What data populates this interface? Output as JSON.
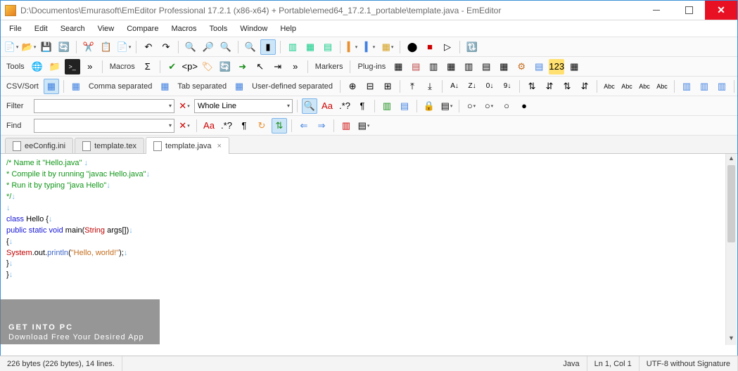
{
  "titlebar": {
    "title": "D:\\Documentos\\Emurasoft\\EmEditor Professional 17.2.1 (x86-x64) + Portable\\emed64_17.2.1_portable\\template.java - EmEditor"
  },
  "menu": {
    "items": [
      "File",
      "Edit",
      "Search",
      "View",
      "Compare",
      "Macros",
      "Tools",
      "Window",
      "Help"
    ]
  },
  "toolbar2_labels": {
    "tools": "Tools",
    "macros": "Macros",
    "markers": "Markers",
    "plugins": "Plug-ins"
  },
  "csv_row": {
    "label": "CSV/Sort",
    "comma": "Comma separated",
    "tab": "Tab separated",
    "user": "User-defined separated"
  },
  "filter_row": {
    "label": "Filter",
    "combo": "Whole Line"
  },
  "find_row": {
    "label": "Find"
  },
  "tabs": [
    {
      "name": "eeConfig.ini",
      "active": false
    },
    {
      "name": "template.tex",
      "active": false
    },
    {
      "name": "template.java",
      "active": true
    }
  ],
  "code": {
    "l1_a": "/* Name it \"Hello.java\" ",
    "l2_a": " * Compile it by running \"javac Hello.java\"",
    "l3_a": " * Run it by typing \"java Hello\"",
    "l4_a": " */",
    "l6_class": "class",
    "l6_name": " Hello {",
    "l7_pub": "public",
    "l7_stat": " static",
    "l7_void": " void",
    "l7_main": " main(",
    "l7_str": "String",
    "l7_args": " args[])",
    "l8": "{",
    "l9_sys": "System",
    "l9_out": ".out.",
    "l9_pr": "println",
    "l9_paren": "(",
    "l9_str": "\"Hello, world!\"",
    "l9_end": ");",
    "l10": "}",
    "l11": "}"
  },
  "watermark": {
    "big": "GET INTO PC",
    "small": "Download Free Your Desired App"
  },
  "status": {
    "bytes": "226 bytes (226 bytes), 14 lines.",
    "lang": "Java",
    "pos": "Ln 1, Col 1",
    "enc": "UTF-8 without Signature"
  }
}
